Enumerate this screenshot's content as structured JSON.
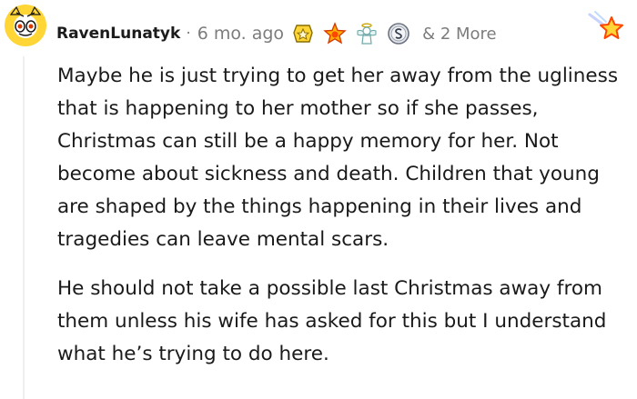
{
  "comment": {
    "username": "RavenLunatyk",
    "separator": "·",
    "timestamp": "6 mo. ago",
    "more_awards": "& 2 More",
    "awards": [
      {
        "icon": "helpful-award-icon"
      },
      {
        "icon": "starstruck-award-icon"
      },
      {
        "icon": "angel-award-icon"
      },
      {
        "icon": "silver-coin-award-icon"
      }
    ],
    "corner_award_icon": "star-award-icon",
    "paragraphs": [
      "Maybe he is just trying to get her away from the ugliness that is happening to her mother so if she passes, Christmas can still be a happy memory for her. Not become about sickness and death. Children that young are shaped by the things happening in their lives and tragedies can leave mental scars.",
      "He should not take a possible last Christmas away from them unless his wife has asked for this but I understand what he’s trying to do here."
    ]
  },
  "colors": {
    "text": "#1a1a1b",
    "meta": "#7c7c7c",
    "thread_line": "#edeff1",
    "avatar_yellow": "#ffd635",
    "award_gold": "#f5a623"
  }
}
